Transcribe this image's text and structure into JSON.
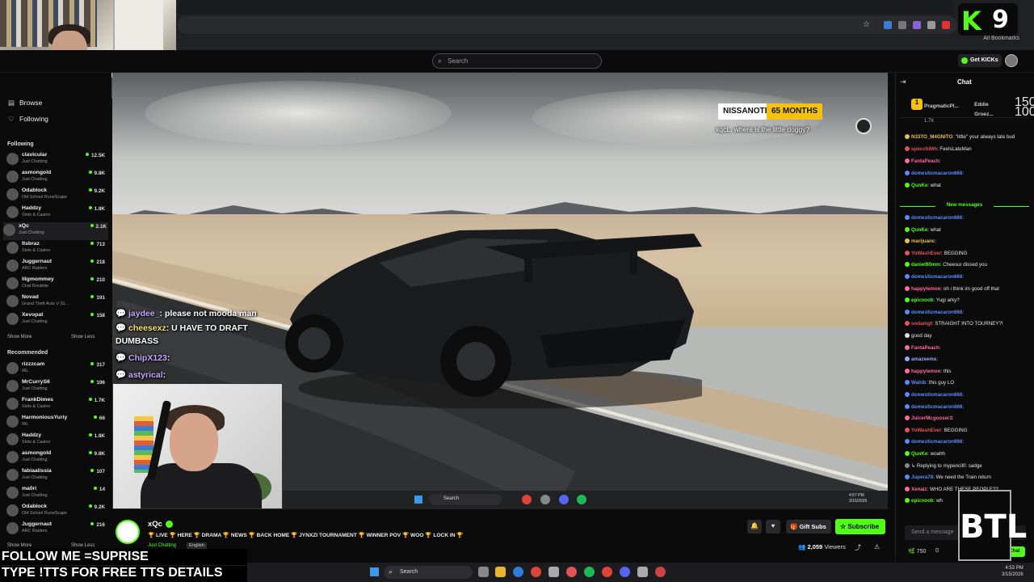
{
  "browser": {
    "bookmarks_label": "All Bookmarks"
  },
  "logo": {
    "letter": "K",
    "number": "9"
  },
  "site": {
    "search_placeholder": "Search",
    "get_kicks": "Get KICKs"
  },
  "sidebar": {
    "nav": [
      {
        "icon": "browse-icon",
        "label": "Browse"
      },
      {
        "icon": "heart-icon",
        "label": "Following"
      }
    ],
    "following_title": "Following",
    "following": [
      {
        "name": "clavicular",
        "category": "Just Chatting",
        "viewers": "12.5K"
      },
      {
        "name": "asmongold",
        "category": "Just Chatting",
        "viewers": "9.8K"
      },
      {
        "name": "Odablock",
        "category": "Old School RuneScape",
        "viewers": "9.2K"
      },
      {
        "name": "Haddzy",
        "category": "Slots & Casino",
        "viewers": "1.8K"
      },
      {
        "name": "xQc",
        "category": "Just Chatting",
        "viewers": "2.1K"
      },
      {
        "name": "Itsbraz",
        "category": "Slots & Casino",
        "viewers": "713"
      },
      {
        "name": "Juggernaut",
        "category": "ARC Raiders",
        "viewers": "218"
      },
      {
        "name": "lilgmommey",
        "category": "Chat Roulette",
        "viewers": "210"
      },
      {
        "name": "Novad",
        "category": "Grand Theft Auto V (G...",
        "viewers": "191"
      },
      {
        "name": "Xevopat",
        "category": "Just Chatting",
        "viewers": "158"
      }
    ],
    "show_more": "Show More",
    "show_less": "Show Less",
    "recommended_title": "Recommended",
    "recommended": [
      {
        "name": "rizzzcam",
        "category": "IRL",
        "viewers": "317"
      },
      {
        "name": "MrCurryS6",
        "category": "Just Chatting",
        "viewers": "196"
      },
      {
        "name": "FrankDimes",
        "category": "Slots & Casino",
        "viewers": "1.7K"
      },
      {
        "name": "HarmoniousYuriy",
        "category": "IRL",
        "viewers": "66"
      },
      {
        "name": "Haddzy",
        "category": "Slots & Casino",
        "viewers": "1.8K"
      },
      {
        "name": "asmongold",
        "category": "Just Chatting",
        "viewers": "9.8K"
      },
      {
        "name": "fabiaalissia",
        "category": "Just Chatting",
        "viewers": "107"
      },
      {
        "name": "ma0ri",
        "category": "Just Chatting",
        "viewers": "14"
      },
      {
        "name": "Odablock",
        "category": "Old School RuneScape",
        "viewers": "9.2K"
      },
      {
        "name": "Juggernaut",
        "category": "ARC Raiders",
        "viewers": "216"
      }
    ]
  },
  "video": {
    "sub_name": "NISSANOTE",
    "sub_months": "65 MONTHS",
    "sub_message": "xqcL, where is the little doggy?",
    "tts": [
      {
        "user": "jaydee_",
        "text": ": please not mooda man"
      },
      {
        "user": "cheesexz",
        "text": ": U HAVE TO DRAFT"
      },
      {
        "user": "",
        "text": "DUMBASS"
      },
      {
        "user": "ChipX123",
        "text": ":"
      },
      {
        "user": "astyrical",
        "text": ":"
      }
    ],
    "taskbar_search": "Search",
    "clock": "4:57 PM\n3/15/2026"
  },
  "chat": {
    "title": "Chat",
    "top_gifters": [
      {
        "name": "PragmaticPl...",
        "count": "1.7K"
      },
      {
        "name": "Eddie",
        "count": "150"
      },
      {
        "name": "Groez...",
        "count": "100"
      }
    ],
    "messages_before": [
      {
        "user": "N33TO_M4GNITO",
        "color": "#e0c05a",
        "text": ": \"little\" your always late bud"
      },
      {
        "user": "specchiMh",
        "color": "#e05555",
        "text": ": FeelsLateMan"
      },
      {
        "user": "FantaPeach",
        "color": "#ff6b9a",
        "text": ":"
      },
      {
        "user": "domesticmacaron666",
        "color": "#5b8cff",
        "text": ":"
      },
      {
        "user": "QunKe",
        "color": "#53fc18",
        "text": ": what"
      }
    ],
    "new_messages": "New messages",
    "messages_after": [
      {
        "user": "domesticmacaron666",
        "color": "#5b8cff",
        "text": ":"
      },
      {
        "user": "QunKe",
        "color": "#53fc18",
        "text": ": what"
      },
      {
        "user": "marijuanc",
        "color": "#e0c05a",
        "text": ":"
      },
      {
        "user": "YoWashEver",
        "color": "#e05555",
        "text": ": BEGGING"
      },
      {
        "user": "daniel90mm",
        "color": "#53fc18",
        "text": ": Cheesur dissed you"
      },
      {
        "user": "domesticmacaron666",
        "color": "#5b8cff",
        "text": ":"
      },
      {
        "user": "happylemon",
        "color": "#ff6b9a",
        "text": ": oh i think im good off that"
      },
      {
        "user": "epicnoob",
        "color": "#53fc18",
        "text": ": Yugi arky?"
      },
      {
        "user": "domesticmacaron666",
        "color": "#5b8cff",
        "text": ":"
      },
      {
        "user": "sodamgt",
        "color": "#e05555",
        "text": ": STRAIGHT INTO TOURNEY?!"
      },
      {
        "user": "",
        "color": "#ddd",
        "text": "good day"
      },
      {
        "user": "FantaPeach",
        "color": "#ff6b9a",
        "text": ":"
      },
      {
        "user": "amazeems",
        "color": "#9aa7ff",
        "text": ":"
      },
      {
        "user": "happylemon",
        "color": "#ff6b9a",
        "text": ": this"
      },
      {
        "user": "Wahib",
        "color": "#5b8cff",
        "text": ": this guy LO"
      },
      {
        "user": "domesticmacaron666",
        "color": "#5b8cff",
        "text": ":"
      },
      {
        "user": "domesticmacaron666",
        "color": "#5b8cff",
        "text": ":"
      },
      {
        "user": "JuicerMcgooser3",
        "color": "#ff6b9a",
        "text": ":"
      },
      {
        "user": "YoWashEver",
        "color": "#e05555",
        "text": ": BEGGING"
      },
      {
        "user": "domesticmacaron666",
        "color": "#5b8cff",
        "text": ":"
      },
      {
        "user": "QunKe",
        "color": "#53fc18",
        "text": ": woahh"
      },
      {
        "user": "",
        "color": "#888",
        "text": "↳ Replying to mypencil0: sadge"
      },
      {
        "user": "Jupera78",
        "color": "#5b8cff",
        "text": ": We need the Train return"
      },
      {
        "user": "Xenaiz",
        "color": "#ff6b9a",
        "text": ": WHO ARE THESE PEOPLE??"
      },
      {
        "user": "epicnoob",
        "color": "#53fc18",
        "text": ": wh"
      }
    ],
    "input_placeholder": "Send a message",
    "points": "750",
    "zero": "0",
    "chat_button": "Chat",
    "btl": "BTL"
  },
  "stream": {
    "name": "xQc",
    "title": "🏆 LIVE 🏆 HERE 🏆 DRAMA 🏆 NEWS 🏆 BACK HOME 🏆 JYNXZI TOURNAMENT 🏆 WINNER POV 🏆 WOO 🏆 LOCK IN 🏆",
    "category": "Just Chatting",
    "language": "English",
    "gift_subs": "Gift Subs",
    "subscribe": "Subscribe",
    "viewers": "2,059",
    "viewers_label": "Viewers"
  },
  "overlay": {
    "follow": "FOLLOW ME =SUPRISE",
    "tts": "TYPE !TTS FOR FREE TTS DETAILS"
  },
  "taskbar": {
    "search": "Search",
    "time": "4:53 PM",
    "date": "3/15/2026"
  },
  "colors": {
    "accent": "#53fc18",
    "background": "#0b0b0c"
  }
}
